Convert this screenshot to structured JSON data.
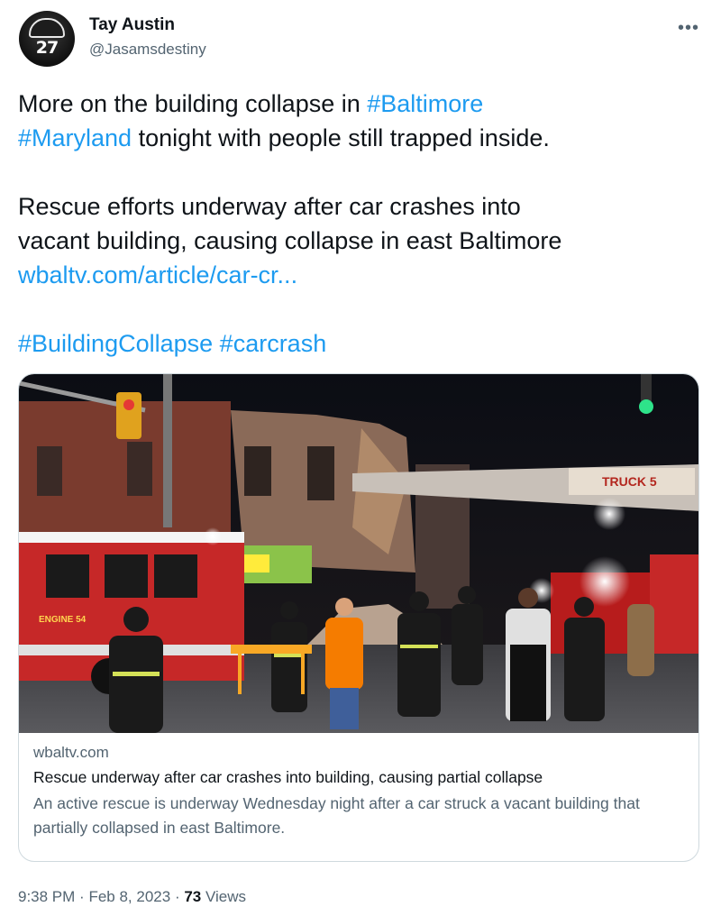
{
  "author": {
    "name": "Tay Austin",
    "handle": "@Jasamsdestiny",
    "avatar_text": "27",
    "avatar_icon": "firefighter-helmet-avatar"
  },
  "more_icon": "more-options-icon",
  "tweet": {
    "line1_text": "More on the building collapse in ",
    "hashtag_baltimore": "#Baltimore",
    "hashtag_maryland": "#Maryland",
    "line2_text": " tonight with people still trapped inside.",
    "para2_line1": "Rescue efforts underway after car crashes into",
    "para2_line2": "vacant building, causing collapse in east Baltimore",
    "link": "wbaltv.com/article/car-cr...",
    "hashtag_collapse": "#BuildingCollapse",
    "hashtag_carcrash": "#carcrash"
  },
  "card": {
    "image_truck_label": "TRUCK 5",
    "image_engine_label": "ENGINE 54",
    "domain": "wbaltv.com",
    "title": "Rescue underway after car crashes into building, causing partial collapse",
    "description": "An active rescue is underway Wednesday night after a car struck a vacant building that partially collapsed in east Baltimore."
  },
  "meta": {
    "time": "9:38 PM",
    "separator": "·",
    "date": "Feb 8, 2023",
    "views_count": "73",
    "views_label": "Views"
  },
  "colors": {
    "link": "#1d9bf0",
    "secondary_text": "#536471",
    "primary_text": "#0f1419",
    "border": "#cfd9de"
  }
}
